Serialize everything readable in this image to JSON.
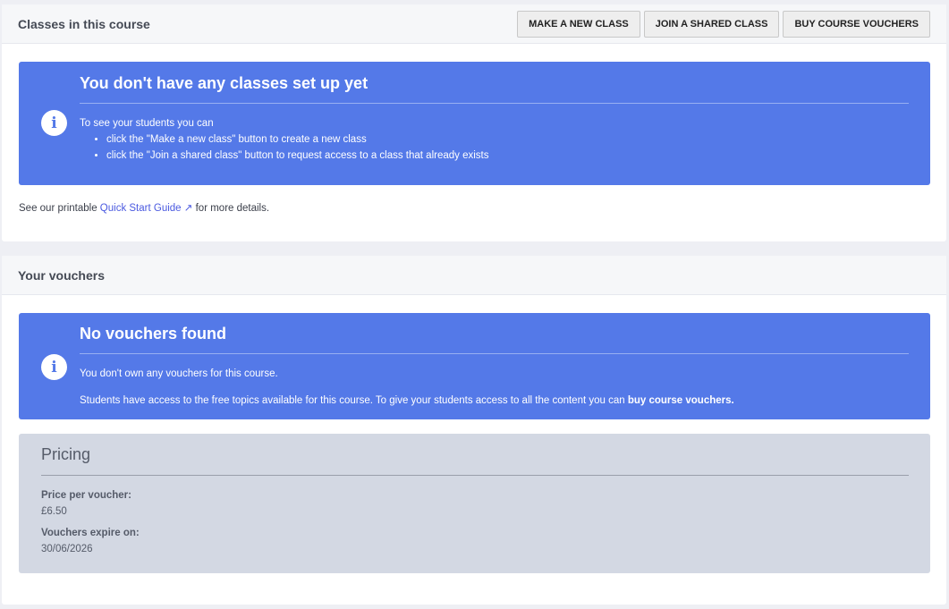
{
  "classes": {
    "title": "Classes in this course",
    "buttons": [
      "MAKE A NEW CLASS",
      "JOIN A SHARED CLASS",
      "BUY COURSE VOUCHERS"
    ],
    "alert": {
      "title": "You don't have any classes set up yet",
      "intro": "To see your students you can",
      "items": [
        "click the \"Make a new class\" button to create a new class",
        "click the \"Join a shared class\" button to request access to a class that already exists"
      ]
    },
    "note_prefix": "See our printable ",
    "note_link": "Quick Start Guide",
    "note_suffix": " for more details."
  },
  "vouchers": {
    "title": "Your vouchers",
    "alert": {
      "title": "No vouchers found",
      "line1": "You don't own any vouchers for this course.",
      "line2": "Students have access to the free topics available for this course. To give your students access to all the content you can ",
      "line2_bold": "buy course vouchers."
    },
    "pricing": {
      "title": "Pricing",
      "price_label": "Price per voucher:",
      "price": "£6.50",
      "expiry_label": "Vouchers expire on:",
      "expiry": "30/06/2026"
    }
  }
}
